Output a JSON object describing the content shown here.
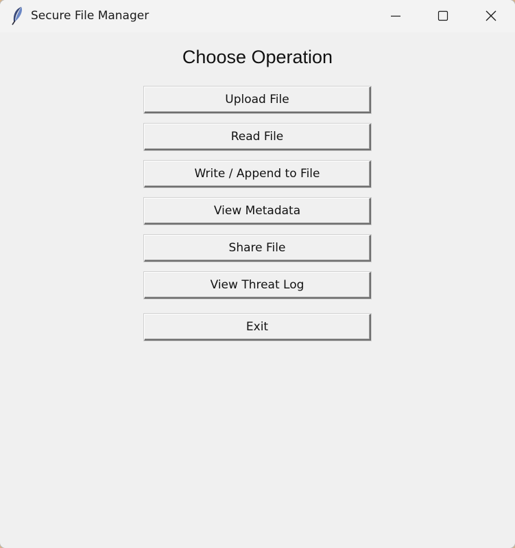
{
  "window": {
    "title": "Secure File Manager",
    "icon": "feather-icon"
  },
  "main": {
    "heading": "Choose Operation",
    "buttons": [
      {
        "label": "Upload File"
      },
      {
        "label": "Read File"
      },
      {
        "label": "Write / Append to File"
      },
      {
        "label": "View Metadata"
      },
      {
        "label": "Share File"
      },
      {
        "label": "View Threat Log"
      },
      {
        "label": "Exit"
      }
    ]
  },
  "colors": {
    "background": "#f0f0f0",
    "titlebar": "#f3f3f3",
    "text": "#111111"
  }
}
